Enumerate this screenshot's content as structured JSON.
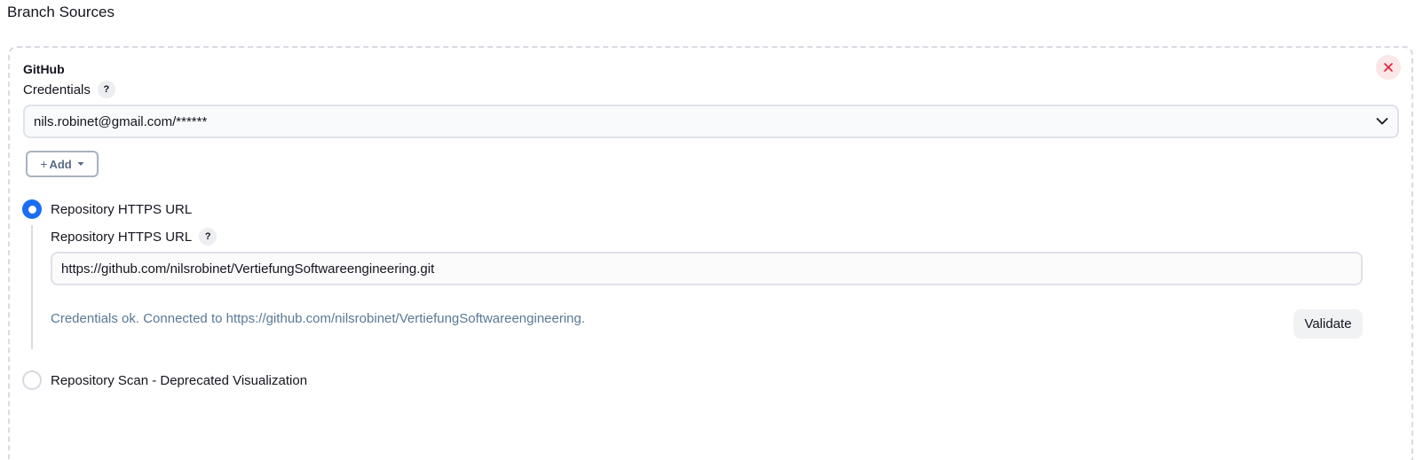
{
  "section": {
    "title": "Branch Sources"
  },
  "source": {
    "heading": "GitHub",
    "delete_icon": "close-icon",
    "credentials": {
      "label": "Credentials",
      "help": "?",
      "selected": "nils.robinet@gmail.com/******",
      "dropdown_icon": "chevron-down-icon"
    },
    "add_button": {
      "plus": "+",
      "label": "Add"
    },
    "options": {
      "https": {
        "label": "Repository HTTPS URL",
        "selected": true
      },
      "scan": {
        "label": "Repository Scan - Deprecated Visualization",
        "selected": false
      }
    },
    "repo_url": {
      "label": "Repository HTTPS URL",
      "help": "?",
      "value": "https://github.com/nilsrobinet/VertiefungSoftwareengineering.git"
    },
    "status_message": "Credentials ok. Connected to https://github.com/nilsrobinet/VertiefungSoftwareengineering.",
    "validate_label": "Validate"
  },
  "colors": {
    "accent": "#1b6ef3",
    "danger": "#e2233a",
    "status_text": "#5a7896"
  }
}
